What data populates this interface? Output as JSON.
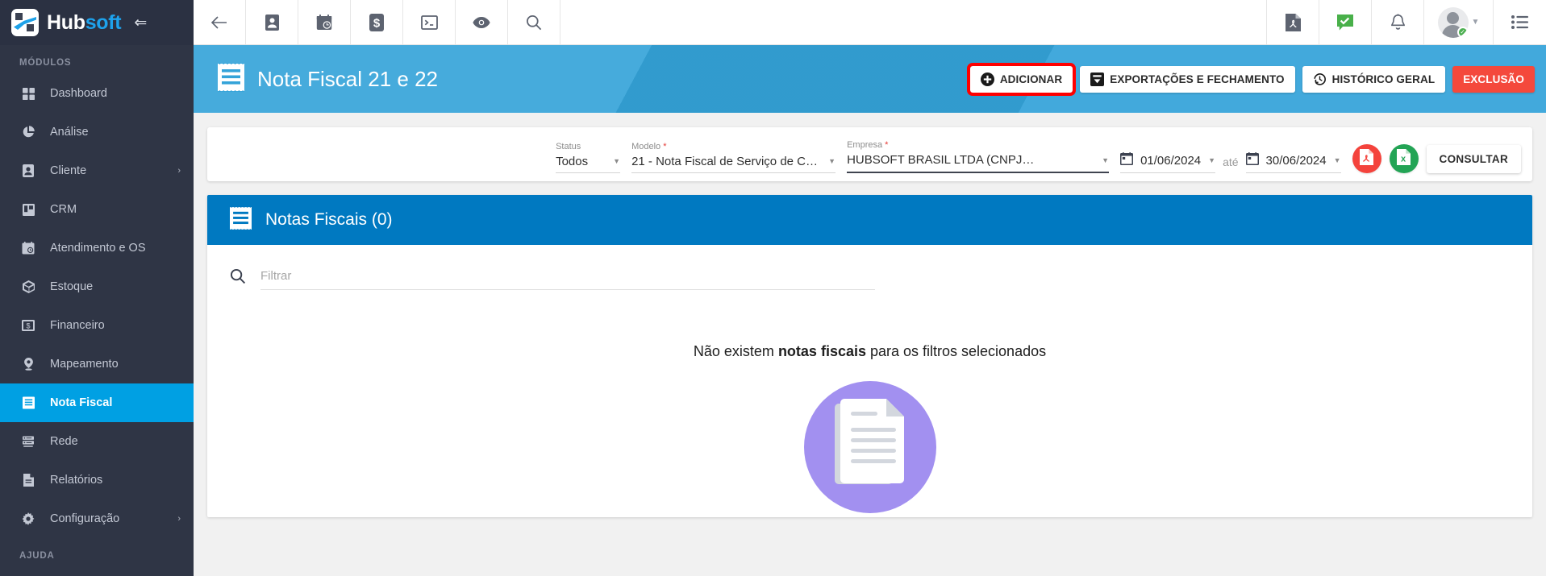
{
  "brand": {
    "name_part1": "Hub",
    "name_part2": "soft",
    "collapse_icon": "arrow-left-long-icon",
    "logo_icon": "hubsoft-logo-icon"
  },
  "sidebar": {
    "section_modulos": "MÓDULOS",
    "section_ajuda": "AJUDA",
    "items": [
      {
        "label": "Dashboard",
        "icon": "dashboard-grid-icon",
        "active": false,
        "expandable": false
      },
      {
        "label": "Análise",
        "icon": "pie-chart-icon",
        "active": false,
        "expandable": false
      },
      {
        "label": "Cliente",
        "icon": "user-card-icon",
        "active": false,
        "expandable": true
      },
      {
        "label": "CRM",
        "icon": "kanban-board-icon",
        "active": false,
        "expandable": false
      },
      {
        "label": "Atendimento e OS",
        "icon": "calendar-clock-icon",
        "active": false,
        "expandable": false
      },
      {
        "label": "Estoque",
        "icon": "box-package-icon",
        "active": false,
        "expandable": false
      },
      {
        "label": "Financeiro",
        "icon": "money-bill-icon",
        "active": false,
        "expandable": false
      },
      {
        "label": "Mapeamento",
        "icon": "map-pin-icon",
        "active": false,
        "expandable": false
      },
      {
        "label": "Nota Fiscal",
        "icon": "invoice-lines-icon",
        "active": true,
        "expandable": false
      },
      {
        "label": "Rede",
        "icon": "server-rack-icon",
        "active": false,
        "expandable": false
      },
      {
        "label": "Relatórios",
        "icon": "document-report-icon",
        "active": false,
        "expandable": false
      },
      {
        "label": "Configuração",
        "icon": "gear-icon",
        "active": false,
        "expandable": true
      }
    ],
    "chevron_glyph": "›"
  },
  "topbar": {
    "left_icons": [
      {
        "name": "back-arrow-icon"
      },
      {
        "name": "contact-card-icon"
      },
      {
        "name": "calendar-clock-icon"
      },
      {
        "name": "dollar-sign-icon"
      },
      {
        "name": "terminal-console-icon"
      },
      {
        "name": "eye-icon"
      },
      {
        "name": "search-icon"
      }
    ],
    "right_icons": [
      {
        "name": "pdf-file-icon"
      },
      {
        "name": "green-check-chat-icon"
      },
      {
        "name": "bell-notification-icon"
      }
    ],
    "avatar_name": "user-avatar",
    "menu_icon": "list-menu-icon"
  },
  "page_header": {
    "icon": "invoice-lines-icon",
    "title": "Nota Fiscal 21 e 22",
    "accent_color": "#34a3d9",
    "buttons": [
      {
        "label": "ADICIONAR",
        "icon": "plus-circle-icon",
        "style": "white",
        "highlighted": true
      },
      {
        "label": "EXPORTAÇÕES E FECHAMENTO",
        "icon": "download-box-icon",
        "style": "white",
        "highlighted": false
      },
      {
        "label": "HISTÓRICO GERAL",
        "icon": "history-clock-icon",
        "style": "white",
        "highlighted": false
      },
      {
        "label": "EXCLUSÃO",
        "icon": "",
        "style": "danger",
        "highlighted": false
      }
    ],
    "highlight_color": "#ff0000",
    "danger_color": "#f4493c"
  },
  "filters": {
    "status": {
      "label": "Status",
      "required": false,
      "value": "Todos"
    },
    "modelo": {
      "label": "Modelo",
      "required": true,
      "value": "21 - Nota Fiscal de Serviço de Com..."
    },
    "empresa": {
      "label": "Empresa",
      "required": true,
      "value": "HUBSOFT BRASIL LTDA (CNPJ",
      "redacted": true
    },
    "date_from": {
      "value": "01/06/2024",
      "icon": "calendar-icon"
    },
    "date_separator": "até",
    "date_to": {
      "value": "30/06/2024",
      "icon": "calendar-icon"
    },
    "export_pdf": {
      "name": "export-pdf-button",
      "icon": "pdf-file-icon",
      "color": "#f4433c"
    },
    "export_xls": {
      "name": "export-excel-button",
      "icon": "excel-file-icon",
      "color": "#23a455"
    },
    "submit_label": "CONSULTAR"
  },
  "list_panel": {
    "icon": "invoice-lines-icon",
    "title": "Notas Fiscais (0)",
    "header_color": "#0079c1",
    "search": {
      "icon": "search-icon",
      "placeholder": "Filtrar",
      "value": ""
    },
    "empty_state": {
      "text_before": "Não existem ",
      "text_bold": "notas fiscais",
      "text_after": " para os filtros selecionados",
      "illustration": "documents-empty-illustration",
      "illustration_color": "#a290f0"
    }
  }
}
